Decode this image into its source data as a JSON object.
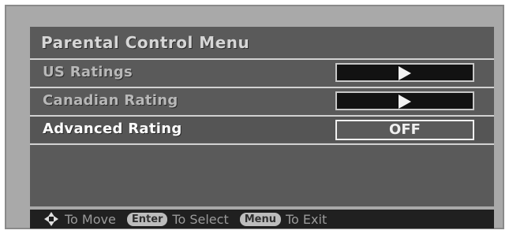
{
  "menu": {
    "title": "Parental Control Menu",
    "rows": [
      {
        "label": "US Ratings",
        "control": "slider"
      },
      {
        "label": "Canadian Rating",
        "control": "slider"
      },
      {
        "label": "Advanced Rating",
        "control": "value",
        "value": "OFF",
        "selected": true
      }
    ]
  },
  "footer": {
    "move_text": "To Move",
    "enter_key": "Enter",
    "select_text": "To Select",
    "menu_key": "Menu",
    "exit_text": "To Exit"
  },
  "icons": {
    "navigation": "dpad-icon"
  },
  "colors": {
    "panel": "#5a5a5a",
    "footer": "#202020",
    "selected_text": "#ffffff",
    "label_text": "#b8b8b8"
  }
}
